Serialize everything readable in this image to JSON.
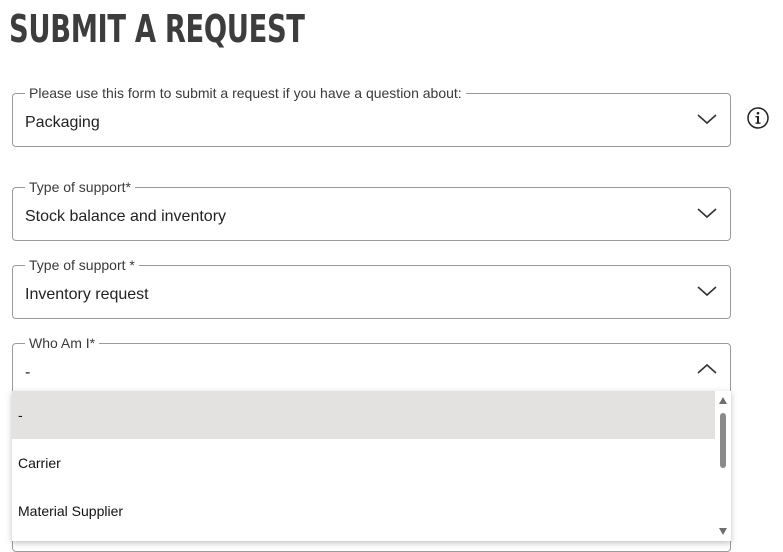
{
  "page": {
    "title": "SUBMIT A REQUEST"
  },
  "fields": [
    {
      "label": "Please use this form to submit a request if you have a question about:",
      "value": "Packaging",
      "state": "collapsed"
    },
    {
      "label": "Type of support*",
      "value": "Stock balance and inventory",
      "state": "collapsed"
    },
    {
      "label": "Type of support *",
      "value": "Inventory request",
      "state": "collapsed"
    },
    {
      "label": "Who Am I*",
      "value": "-",
      "state": "expanded"
    }
  ],
  "dropdown": {
    "options": [
      "-",
      "Carrier",
      "Material Supplier"
    ],
    "selected_index": 0
  },
  "icons": {
    "info": "info-circle-icon",
    "chevron_down": "chevron-down-icon",
    "chevron_up": "chevron-up-icon"
  },
  "colors": {
    "border": "#9a9a9a",
    "selected_option_bg": "#e3e2e1",
    "title": "#3d3d3d"
  }
}
